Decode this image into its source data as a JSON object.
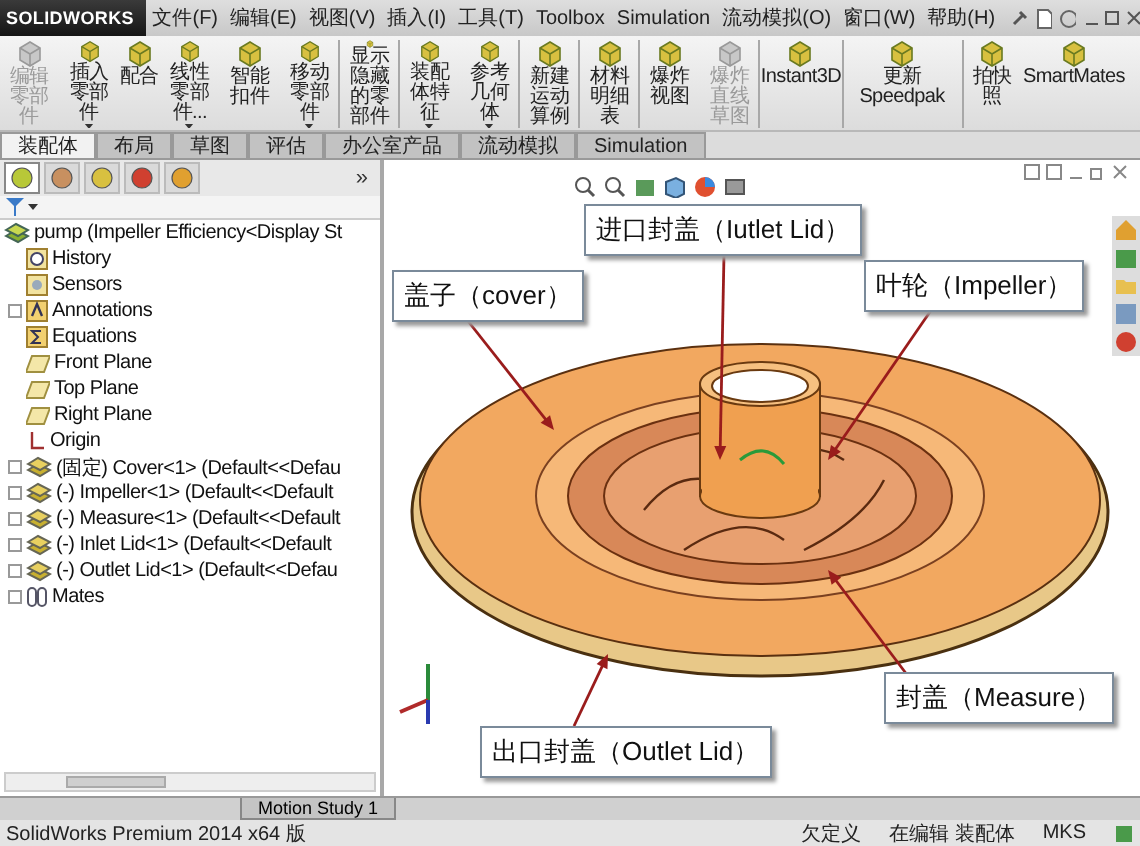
{
  "app": {
    "logo": "SOLIDWORKS"
  },
  "menu": [
    "文件(F)",
    "编辑(E)",
    "视图(V)",
    "插入(I)",
    "工具(T)",
    "Toolbox",
    "Simulation",
    "流动模拟(O)",
    "窗口(W)",
    "帮助(H)"
  ],
  "toolbar": [
    {
      "label": "编辑零部件",
      "disabled": true,
      "dropdown": false,
      "separator_after": false
    },
    {
      "label": "插入零部件",
      "disabled": false,
      "dropdown": true,
      "separator_after": false
    },
    {
      "label": "配合",
      "disabled": false,
      "dropdown": false,
      "separator_after": false
    },
    {
      "label": "线性零部件...",
      "disabled": false,
      "dropdown": true,
      "separator_after": false
    },
    {
      "label": "智能扣件",
      "disabled": false,
      "dropdown": false,
      "separator_after": false
    },
    {
      "label": "移动零部件",
      "disabled": false,
      "dropdown": true,
      "separator_after": true
    },
    {
      "label": "显示隐藏的零部件",
      "disabled": false,
      "dropdown": false,
      "separator_after": true
    },
    {
      "label": "装配体特征",
      "disabled": false,
      "dropdown": true,
      "separator_after": false
    },
    {
      "label": "参考几何体",
      "disabled": false,
      "dropdown": true,
      "separator_after": true
    },
    {
      "label": "新建运动算例",
      "disabled": false,
      "dropdown": false,
      "separator_after": true
    },
    {
      "label": "材料明细表",
      "disabled": false,
      "dropdown": false,
      "separator_after": true
    },
    {
      "label": "爆炸视图",
      "disabled": false,
      "dropdown": false,
      "separator_after": false
    },
    {
      "label": "爆炸直线草图",
      "disabled": true,
      "dropdown": false,
      "separator_after": true
    },
    {
      "label": "Instant3D",
      "disabled": false,
      "dropdown": false,
      "separator_after": true
    },
    {
      "label": "更新Speedpak",
      "disabled": false,
      "dropdown": false,
      "separator_after": true
    },
    {
      "label": "拍快照",
      "disabled": false,
      "dropdown": false,
      "separator_after": false
    },
    {
      "label": "SmartMates",
      "disabled": false,
      "dropdown": false,
      "separator_after": false
    }
  ],
  "command_tabs": [
    {
      "label": "装配体",
      "selected": true
    },
    {
      "label": "布局",
      "selected": false
    },
    {
      "label": "草图",
      "selected": false
    },
    {
      "label": "评估",
      "selected": false
    },
    {
      "label": "办公室产品",
      "selected": false
    },
    {
      "label": "流动模拟",
      "selected": false
    },
    {
      "label": "Simulation",
      "selected": false
    }
  ],
  "panel_tabs": [
    {
      "kind": "tree",
      "selected": true
    },
    {
      "kind": "properties",
      "selected": false
    },
    {
      "kind": "config",
      "selected": false
    },
    {
      "kind": "appearance",
      "selected": false
    },
    {
      "kind": "display",
      "selected": false
    }
  ],
  "panel_more": "»",
  "tree": {
    "label": "pump  (Impeller Efficiency<Display St",
    "children": [
      {
        "kind": "history",
        "label": "History",
        "expandable": false
      },
      {
        "kind": "sensors",
        "label": "Sensors",
        "expandable": false
      },
      {
        "kind": "annotations",
        "label": "Annotations",
        "expandable": true
      },
      {
        "kind": "equations",
        "label": "Equations",
        "expandable": false
      },
      {
        "kind": "plane",
        "label": "Front Plane",
        "expandable": false
      },
      {
        "kind": "plane",
        "label": "Top Plane",
        "expandable": false
      },
      {
        "kind": "plane",
        "label": "Right Plane",
        "expandable": false
      },
      {
        "kind": "origin",
        "label": "Origin",
        "expandable": false
      },
      {
        "kind": "component",
        "label": "(固定) Cover<1> (Default<<Defau",
        "expandable": true
      },
      {
        "kind": "component",
        "label": "(-) Impeller<1> (Default<<Default",
        "expandable": true
      },
      {
        "kind": "component",
        "label": "(-) Measure<1> (Default<<Default",
        "expandable": true
      },
      {
        "kind": "component",
        "label": "(-) Inlet Lid<1> (Default<<Default",
        "expandable": true
      },
      {
        "kind": "component",
        "label": "(-) Outlet Lid<1> (Default<<Defau",
        "expandable": true
      },
      {
        "kind": "mates",
        "label": "Mates",
        "expandable": true
      }
    ]
  },
  "callouts": [
    "进口封盖（Iutlet Lid）",
    "盖子（cover）",
    "叶轮（Impeller）",
    "封盖（Measure）",
    "出口封盖（Outlet Lid）"
  ],
  "bottom_tabs": [
    {
      "label": "Motion Study 1",
      "selected": false
    }
  ],
  "status_bar": {
    "product": "SolidWorks Premium 2014 x64 版",
    "items": [
      "欠定义",
      "在编辑 装配体",
      "MKS"
    ]
  }
}
